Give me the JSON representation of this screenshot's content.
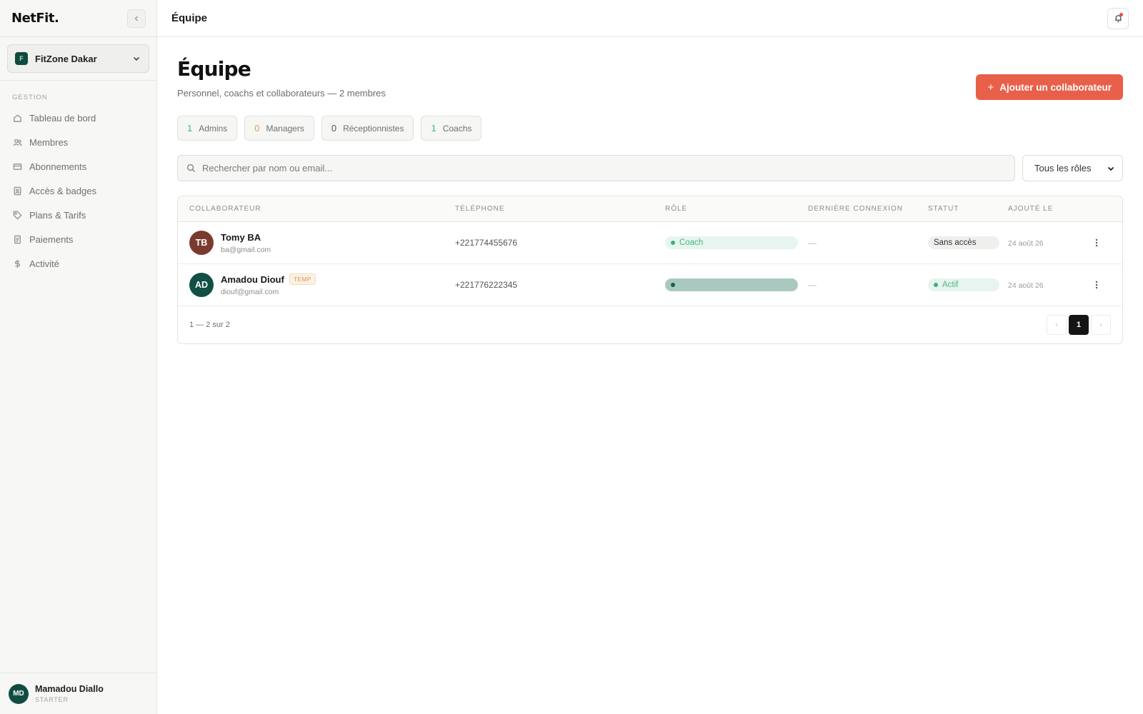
{
  "app": {
    "brand": "NetFit.",
    "collapse_icon": "chevron-left-icon"
  },
  "workspace": {
    "logo_letter": "F",
    "name": "FitZone Dakar"
  },
  "sidebar": {
    "section_label": "GESTION",
    "items": [
      {
        "label": "Tableau de bord",
        "icon": "home-icon"
      },
      {
        "label": "Membres",
        "icon": "users-icon"
      },
      {
        "label": "Abonnements",
        "icon": "card-icon"
      },
      {
        "label": "Accès & badges",
        "icon": "badge-icon"
      },
      {
        "label": "Plans & Tarifs",
        "icon": "tag-icon"
      },
      {
        "label": "Paiements",
        "icon": "receipt-icon"
      },
      {
        "label": "Activité",
        "icon": "dollar-icon"
      }
    ]
  },
  "user": {
    "initials": "MD",
    "name": "Mamadou Diallo",
    "plan": "STARTER"
  },
  "topbar": {
    "title": "Équipe"
  },
  "page": {
    "title": "Équipe",
    "subtitle": "Personnel, coachs et collaborateurs — 2 membres",
    "add_button": "Ajouter un collaborateur",
    "add_icon": "+"
  },
  "stats": [
    {
      "count": "1",
      "label": "Admins",
      "color": "#49b48a"
    },
    {
      "count": "0",
      "label": "Managers",
      "color": "#e0a24c"
    },
    {
      "count": "0",
      "label": "Réceptionnistes",
      "color": "#555555"
    },
    {
      "count": "1",
      "label": "Coachs",
      "color": "#49b48a"
    }
  ],
  "filters": {
    "search_placeholder": "Rechercher par nom ou email...",
    "role_select": "Tous les rôles"
  },
  "table": {
    "columns": [
      "COLLABORATEUR",
      "TÉLÉPHONE",
      "RÔLE",
      "DERNIÈRE CONNEXION",
      "STATUT",
      "AJOUTÉ LE"
    ],
    "rows": [
      {
        "initials": "TB",
        "avatar_color": "#7a3b2e",
        "name": "Tomy BA",
        "tag": "",
        "email": "ba@gmail.com",
        "phone": "+221774455676",
        "role": "Coach",
        "last_login": "—",
        "status": "Sans accès",
        "added": "24 août 26"
      },
      {
        "initials": "AD",
        "avatar_color": "#124f44",
        "name": "Amadou Diouf",
        "tag": "TEMP",
        "email": "diouf@gmail.com",
        "phone": "+221776222345",
        "role": "",
        "last_login": "—",
        "status": "Actif",
        "added": "24 août 26"
      }
    ],
    "range_text": "1 — 2 sur 2",
    "pager": {
      "prev": "‹",
      "current": "1",
      "next": "›"
    }
  },
  "colors": {
    "accent": "#e8604a",
    "brand_dark": "#0f4a3f",
    "success": "#49b48a"
  }
}
